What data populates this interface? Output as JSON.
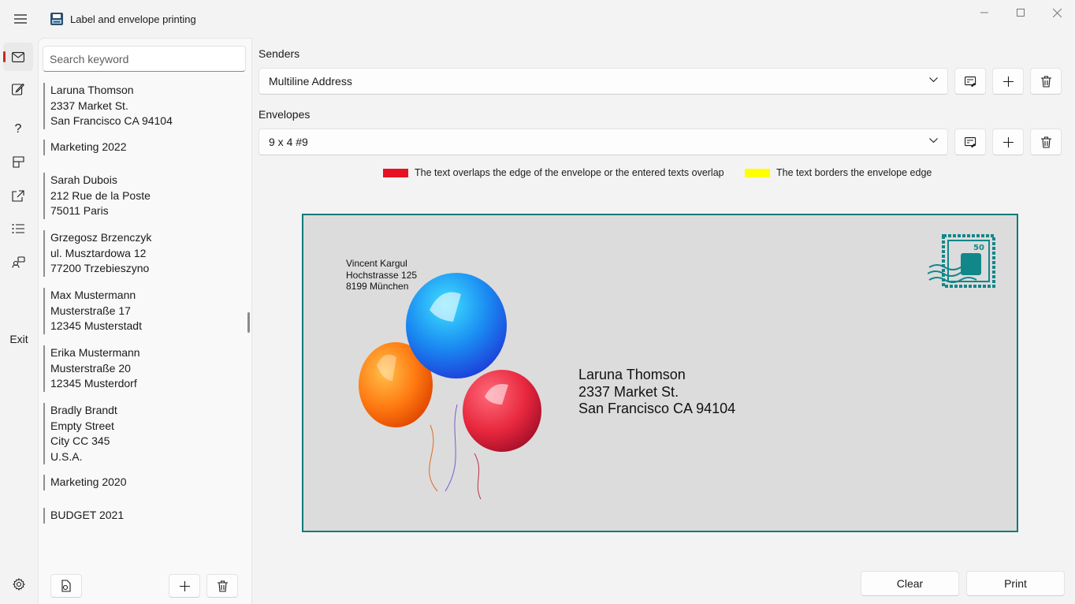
{
  "window": {
    "title": "Label and envelope printing",
    "icons": [
      "hamburger-menu-icon",
      "printer-app-icon",
      "minimize-icon",
      "maximize-icon",
      "close-icon"
    ]
  },
  "nav": {
    "items": [
      {
        "name": "envelope",
        "icon": "mail-icon",
        "selected": true
      },
      {
        "name": "edit",
        "icon": "edit-icon"
      },
      {
        "name": "help",
        "icon": "help-icon"
      },
      {
        "name": "layout",
        "icon": "layout-icon"
      },
      {
        "name": "share",
        "icon": "share-icon"
      },
      {
        "name": "list",
        "icon": "list-icon"
      },
      {
        "name": "people",
        "icon": "people-icon"
      }
    ],
    "exit_label": "Exit",
    "settings_icon": "gear-icon",
    "accent_color": "#c42b1c"
  },
  "address_list": {
    "search_placeholder": "Search keyword",
    "items": [
      {
        "lines": [
          "Laruna Thomson",
          "2337 Market St.",
          "San Francisco CA 94104"
        ]
      },
      {
        "lines": [
          "Marketing 2022"
        ]
      },
      {
        "lines": [
          "Sarah Dubois",
          "212 Rue de la Poste",
          "75011 Paris"
        ]
      },
      {
        "lines": [
          "Grzegosz Brzenczyk",
          "ul. Musztardowa 12",
          "77200 Trzebieszyno"
        ]
      },
      {
        "lines": [
          "Max Mustermann",
          "Musterstraße 17",
          "12345 Musterstadt"
        ]
      },
      {
        "lines": [
          "Erika Mustermann",
          "Musterstraße 20",
          "12345 Musterdorf"
        ]
      },
      {
        "lines": [
          "Bradly Brandt",
          "Empty Street",
          "City CC 345",
          "U.S.A."
        ]
      },
      {
        "lines": [
          "Marketing 2020"
        ]
      },
      {
        "lines": [
          "BUDGET 2021"
        ]
      }
    ]
  },
  "senders": {
    "label": "Senders",
    "selected": "Multiline Address"
  },
  "envelopes": {
    "label": "Envelopes",
    "selected": "9 x 4 #9"
  },
  "legend": {
    "overlap_text": "The text overlaps the edge of the envelope or the entered texts overlap",
    "overlap_color": "#e81123",
    "border_text": "The text borders the envelope edge",
    "border_color": "#ffff00"
  },
  "envelope_preview": {
    "sender": {
      "line1": "Vincent Kargul",
      "line2": "Hochstrasse 125",
      "line3": "8199 München"
    },
    "recipient": {
      "line1": "Laruna Thomson",
      "line2": "2337 Market St.",
      "line3": "San Francisco CA 94104"
    },
    "stamp_value": "50",
    "stamp_color": "#12878a",
    "border_color": "#117a7a",
    "background": "#dcdcdc"
  },
  "actions": {
    "clear_label": "Clear",
    "print_label": "Print"
  }
}
